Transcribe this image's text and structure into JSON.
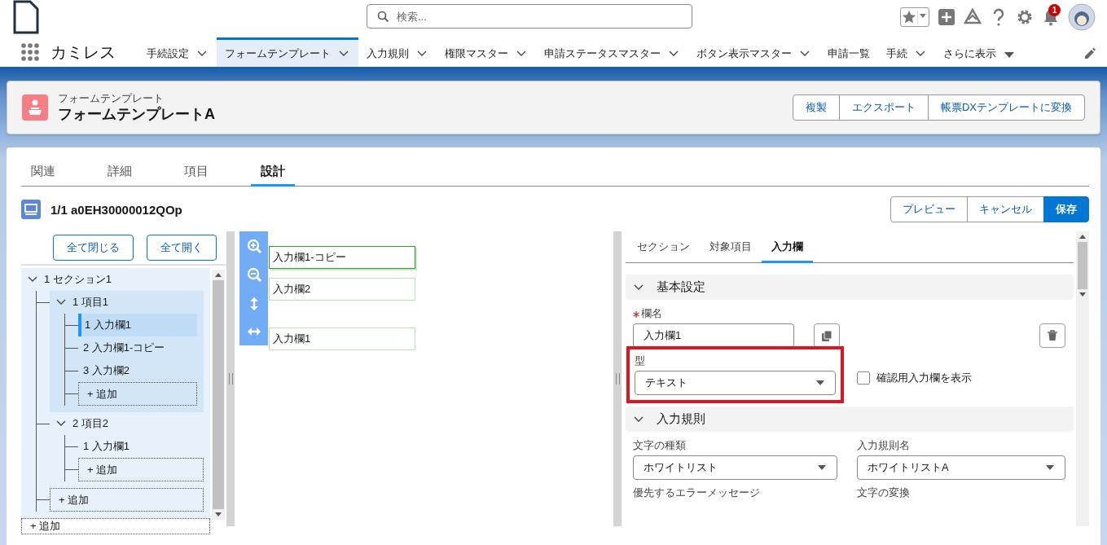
{
  "top_bar": {
    "search_placeholder": "検索...",
    "notification_count": "1"
  },
  "nav": {
    "app_name": "カミレス",
    "items": [
      {
        "label": "手続設定",
        "kind": "menu",
        "selected": false
      },
      {
        "label": "フォームテンプレート",
        "kind": "menu",
        "selected": true
      },
      {
        "label": "入力規則",
        "kind": "menu",
        "selected": false
      },
      {
        "label": "権限マスター",
        "kind": "menu",
        "selected": false
      },
      {
        "label": "申請ステータスマスター",
        "kind": "menu",
        "selected": false
      },
      {
        "label": "ボタン表示マスター",
        "kind": "menu",
        "selected": false
      },
      {
        "label": "申請一覧",
        "kind": "link",
        "selected": false
      },
      {
        "label": "手続",
        "kind": "menu",
        "selected": false
      },
      {
        "label": "さらに表示",
        "kind": "overflow",
        "selected": false
      }
    ]
  },
  "record": {
    "object_type": "フォームテンプレート",
    "name": "フォームテンプレートA",
    "actions": [
      "複製",
      "エクスポート",
      "帳票DXテンプレートに変換"
    ]
  },
  "tabs": [
    {
      "label": "関連",
      "selected": false
    },
    {
      "label": "詳細",
      "selected": false
    },
    {
      "label": "項目",
      "selected": false
    },
    {
      "label": "設計",
      "selected": true
    }
  ],
  "designer": {
    "title": "1/1 a0EH30000012QOp",
    "buttons": [
      {
        "label": "プレビュー",
        "kind": "neutral"
      },
      {
        "label": "キャンセル",
        "kind": "neutral"
      },
      {
        "label": "保存",
        "kind": "brand"
      }
    ]
  },
  "tree_buttons": [
    "全て閉じる",
    "全て開く"
  ],
  "tree": [
    {
      "kind": "node",
      "label": "1 セクション1",
      "expanded": true,
      "children": [
        {
          "kind": "node",
          "label": "1 項目1",
          "expanded": true,
          "children": [
            {
              "kind": "node",
              "label": "1 入力欄1",
              "selected": true
            },
            {
              "kind": "node",
              "label": "2 入力欄1-コピー",
              "selected": false
            },
            {
              "kind": "node",
              "label": "3 入力欄2",
              "selected": false
            },
            {
              "kind": "add",
              "label": "+ 追加"
            }
          ]
        },
        {
          "kind": "node",
          "label": "2 項目2",
          "expanded": true,
          "children": [
            {
              "kind": "node",
              "label": "1 入力欄1",
              "selected": false
            },
            {
              "kind": "add",
              "label": "+ 追加"
            }
          ]
        },
        {
          "kind": "add",
          "label": "+ 追加"
        }
      ]
    },
    {
      "kind": "add",
      "label": "+ 追加"
    }
  ],
  "canvas": {
    "fields": [
      {
        "label": "入力欄1-コピー",
        "selected": true
      },
      {
        "label": "入力欄2",
        "selected": false
      },
      {
        "label": "入力欄1",
        "selected": false
      }
    ]
  },
  "properties": {
    "tabs": [
      {
        "label": "セクション",
        "selected": false
      },
      {
        "label": "対象項目",
        "selected": false
      },
      {
        "label": "入力欄",
        "selected": true
      }
    ],
    "sections": [
      {
        "title": "基本設定",
        "expanded": true,
        "fields": [
          {
            "kind": "text",
            "label": "欄名",
            "required": true,
            "value": "入力欄1"
          },
          {
            "kind": "select",
            "label": "型",
            "value": "テキスト",
            "highlighted": true
          },
          {
            "kind": "checkbox",
            "label": "確認用入力欄を表示",
            "checked": false
          }
        ]
      },
      {
        "title": "入力規則",
        "expanded": true,
        "fields": [
          {
            "kind": "select",
            "label": "文字の種類",
            "value": "ホワイトリスト",
            "highlighted": false
          },
          {
            "kind": "select",
            "label": "入力規則名",
            "value": "ホワイトリストA",
            "highlighted": false
          },
          {
            "kind": "caption",
            "label": "優先するエラーメッセージ"
          },
          {
            "kind": "caption",
            "label": "文字の変換"
          }
        ]
      }
    ]
  }
}
